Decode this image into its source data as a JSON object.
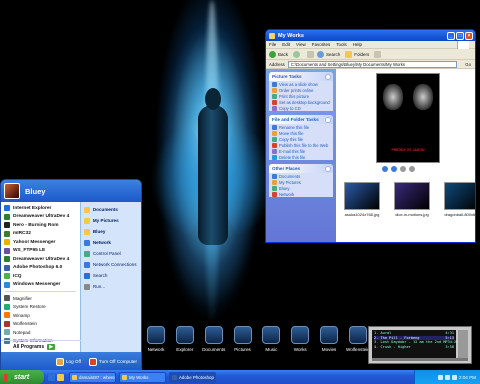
{
  "start_menu": {
    "username": "Bluey",
    "pinned": [
      {
        "label": "Internet Explorer",
        "color": "#1e6fd9"
      },
      {
        "label": "Dreamweaver UltraDev 4",
        "color": "#2e7d32"
      },
      {
        "label": "Nero - Burning Rom",
        "color": "#222222"
      },
      {
        "label": "mIRC32",
        "color": "#3a7b3a"
      },
      {
        "label": "Yahoo! Messenger",
        "color": "#e8b400"
      },
      {
        "label": "WS_FTP95 LE",
        "color": "#6b4fa0"
      },
      {
        "label": "Dreamweaver UltraDev 4",
        "color": "#2e7d32"
      },
      {
        "label": "Adobe Photoshop 6.0",
        "color": "#3a5fa8"
      },
      {
        "label": "ICQ",
        "color": "#4caf50"
      },
      {
        "label": "Windows Messenger",
        "color": "#2b8ae0"
      }
    ],
    "recent": [
      {
        "label": "Magnifier",
        "color": "#555"
      },
      {
        "label": "System Restore",
        "color": "#2a7"
      },
      {
        "label": "Winamp",
        "color": "#f70"
      },
      {
        "label": "Wolfenstein",
        "color": "#a33"
      },
      {
        "label": "Notepad",
        "color": "#7aa"
      },
      {
        "label": "System Information",
        "color": "#47a"
      }
    ],
    "all_programs": "All Programs",
    "places": [
      {
        "label": "Documents",
        "bold": true,
        "color": "#f2c94c"
      },
      {
        "label": "My Pictures",
        "bold": true,
        "color": "#f2c94c"
      },
      {
        "label": "Bluey",
        "bold": true,
        "color": "#f2c94c"
      },
      {
        "label": "Network",
        "bold": true,
        "color": "#3a7bd5"
      },
      {
        "label": "Control Panel",
        "bold": false,
        "color": "#4a8"
      },
      {
        "label": "Network Connections",
        "bold": false,
        "color": "#3a7bd5"
      },
      {
        "label": "Search",
        "bold": false,
        "color": "#2a6fd1"
      },
      {
        "label": "Run...",
        "bold": false,
        "color": "#888"
      }
    ],
    "log_off": "Log Off",
    "turn_off": "Turn Off Computer"
  },
  "explorer": {
    "title": "My Works",
    "menu": [
      "File",
      "Edit",
      "View",
      "Favorites",
      "Tools",
      "Help"
    ],
    "toolbar": {
      "back": "Back",
      "search": "Search",
      "folders": "Folders"
    },
    "address_label": "Address",
    "address_value": "C:\\Documents and Settings\\Bluey\\My Documents\\My Works",
    "go": "Go",
    "picture_tasks": {
      "title": "Picture Tasks",
      "items": [
        "View as a slide show",
        "Order prints online",
        "Print this picture",
        "Set as desktop background",
        "Copy to CD"
      ]
    },
    "file_tasks": {
      "title": "File and Folder Tasks",
      "items": [
        "Rename this file",
        "Move this file",
        "Copy this file",
        "Publish this file to the Web",
        "E-mail this file",
        "Delete this file"
      ]
    },
    "other_places": {
      "title": "Other Places",
      "items": [
        "Documents",
        "My Pictures",
        "Bluey",
        "Network"
      ]
    },
    "preview_caption": "FREDDY VS JASON",
    "thumbnails": [
      {
        "label": "asuka1024x768.jpg",
        "color": "#2a5aa8"
      },
      {
        "label": "dice-in-motions.jpg",
        "color": "#3b2a7a"
      },
      {
        "label": "dragonball-800x600",
        "color": "#0e4a7a"
      }
    ]
  },
  "dock": [
    "Network",
    "Explorer",
    "Documents",
    "Pictures",
    "Music",
    "Works",
    "Movies",
    "Wolfenstein"
  ],
  "player": {
    "tracks": [
      {
        "title": "1. Aural",
        "time": "4:31"
      },
      {
        "title": "2. The Pill - Forbeng",
        "time": "5:13"
      },
      {
        "title": "3. Lost Daydobr - 12 am the 2nd MP3",
        "time": "4:26"
      },
      {
        "title": "4. Crush - Higher",
        "time": "3:58"
      }
    ]
  },
  "taskbar": {
    "start": "start",
    "tasks": [
      {
        "label": "dsmaint87 : where ...",
        "active": false
      },
      {
        "label": "My Works",
        "active": false
      },
      {
        "label": "Adobe Photoshop",
        "active": true
      }
    ],
    "clock": "2:04 PM"
  }
}
